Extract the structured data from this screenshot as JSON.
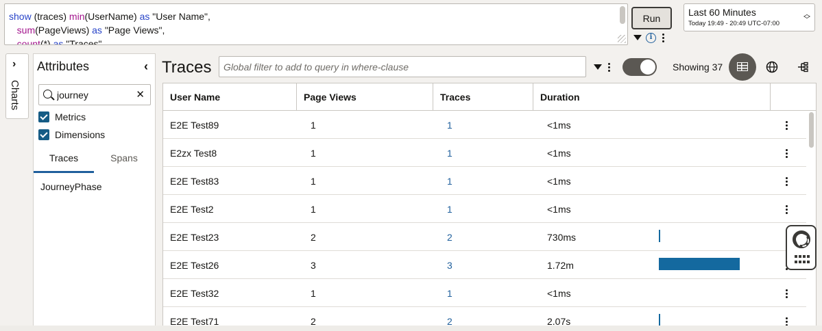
{
  "query": {
    "lines": [
      [
        {
          "t": "show",
          "c": "kw-blue"
        },
        {
          "t": " (traces) ",
          "c": ""
        },
        {
          "t": "min",
          "c": "kw-purple"
        },
        {
          "t": "(UserName) ",
          "c": ""
        },
        {
          "t": "as",
          "c": "kw-blue"
        },
        {
          "t": " \"User Name\",",
          "c": ""
        }
      ],
      [
        {
          "t": "   ",
          "c": ""
        },
        {
          "t": "sum",
          "c": "kw-purple"
        },
        {
          "t": "(PageViews) ",
          "c": ""
        },
        {
          "t": "as",
          "c": "kw-blue"
        },
        {
          "t": " \"Page Views\",",
          "c": ""
        }
      ],
      [
        {
          "t": "   ",
          "c": ""
        },
        {
          "t": "count",
          "c": "kw-purple"
        },
        {
          "t": "(*) ",
          "c": ""
        },
        {
          "t": "as",
          "c": "kw-blue"
        },
        {
          "t": " \"Traces\",",
          "c": ""
        }
      ]
    ],
    "run_label": "Run"
  },
  "time_range": {
    "label": "Last 60 Minutes",
    "detail": "Today 19:49 - 20:49 UTC-07:00"
  },
  "rail": {
    "charts_label": "Charts"
  },
  "attributes": {
    "title": "Attributes",
    "search_value": "journey",
    "checks": [
      {
        "label": "Metrics",
        "checked": true
      },
      {
        "label": "Dimensions",
        "checked": true
      }
    ],
    "tabs": [
      {
        "label": "Traces",
        "active": true
      },
      {
        "label": "Spans",
        "active": false
      }
    ],
    "items": [
      "JourneyPhase"
    ]
  },
  "main": {
    "title": "Traces",
    "filter_placeholder": "Global filter to add to query in where-clause",
    "showing": "Showing 37"
  },
  "table": {
    "columns": [
      "User Name",
      "Page Views",
      "Traces",
      "Duration"
    ],
    "rows": [
      {
        "user": "E2E Test89",
        "views": "1",
        "traces": "1",
        "duration": "<1ms",
        "bar": 0
      },
      {
        "user": "E2zx Test8",
        "views": "1",
        "traces": "1",
        "duration": "<1ms",
        "bar": 0
      },
      {
        "user": "E2E Test83",
        "views": "1",
        "traces": "1",
        "duration": "<1ms",
        "bar": 0
      },
      {
        "user": "E2E Test2",
        "views": "1",
        "traces": "1",
        "duration": "<1ms",
        "bar": 0
      },
      {
        "user": "E2E Test23",
        "views": "2",
        "traces": "2",
        "duration": "730ms",
        "bar": 0.012
      },
      {
        "user": "E2E Test26",
        "views": "3",
        "traces": "3",
        "duration": "1.72m",
        "bar": 1.0
      },
      {
        "user": "E2E Test32",
        "views": "1",
        "traces": "1",
        "duration": "<1ms",
        "bar": 0
      },
      {
        "user": "E2E Test71",
        "views": "2",
        "traces": "2",
        "duration": "2.07s",
        "bar": 0.02
      }
    ]
  },
  "colors": {
    "accent": "#1f5f9c",
    "bar": "#14699f",
    "checkbox": "#165c85",
    "dark_control": "#5b5853"
  },
  "icons": [
    "chevron-right-icon",
    "chevron-left-icon",
    "search-icon",
    "clear-icon",
    "caret-down-icon",
    "info-icon",
    "kebab-icon",
    "table-view-icon",
    "globe-icon",
    "tree-icon",
    "lifebuoy-icon",
    "grid-dots-icon",
    "updown-chevron-icon"
  ]
}
